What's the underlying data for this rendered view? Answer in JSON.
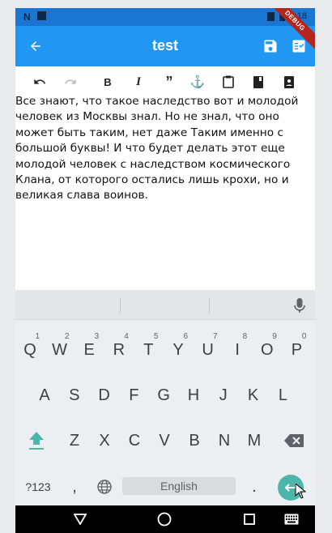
{
  "status_bar": {
    "time": "5:18",
    "debug_label": "DEBUG"
  },
  "app_bar": {
    "title": "test"
  },
  "editor": {
    "text": "Все знают, что такое наследство вот и молодой человек из Москвы знал. Но не знал, что оно может быть таким, нет даже Таким именно с большой буквы! И что будет делать этот еще молодой человек с наследством космического Клана, от которого остались лишь крохи, но и великая слава воинов."
  },
  "keyboard": {
    "row1": [
      {
        "key": "Q",
        "num": "1"
      },
      {
        "key": "W",
        "num": "2"
      },
      {
        "key": "E",
        "num": "3"
      },
      {
        "key": "R",
        "num": "4"
      },
      {
        "key": "T",
        "num": "5"
      },
      {
        "key": "Y",
        "num": "6"
      },
      {
        "key": "U",
        "num": "7"
      },
      {
        "key": "I",
        "num": "8"
      },
      {
        "key": "O",
        "num": "9"
      },
      {
        "key": "P",
        "num": "0"
      }
    ],
    "row2": [
      "A",
      "S",
      "D",
      "F",
      "G",
      "H",
      "J",
      "K",
      "L"
    ],
    "row3": [
      "Z",
      "X",
      "C",
      "V",
      "B",
      "N",
      "M"
    ],
    "symbols_label": "?123",
    "comma": ",",
    "period": ".",
    "space_label": "English"
  },
  "colors": {
    "app_bar": "#2196f3",
    "status_bar": "#1976d2",
    "accent": "#4db6ac"
  }
}
